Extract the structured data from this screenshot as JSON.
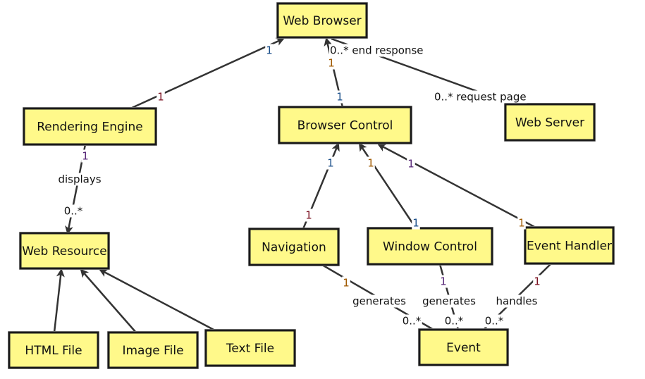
{
  "diagram": {
    "type": "uml-class-diagram",
    "colors": {
      "box_fill": "#fff98a",
      "box_border": "#1a1a1a",
      "edge": "#333333"
    },
    "nodes": [
      {
        "id": "web-browser",
        "label": "Web Browser"
      },
      {
        "id": "rendering-engine",
        "label": "Rendering Engine"
      },
      {
        "id": "browser-control",
        "label": "Browser Control"
      },
      {
        "id": "web-server",
        "label": "Web Server"
      },
      {
        "id": "web-resource",
        "label": "Web Resource"
      },
      {
        "id": "navigation",
        "label": "Navigation"
      },
      {
        "id": "window-control",
        "label": "Window Control"
      },
      {
        "id": "event-handler",
        "label": "Event Handler"
      },
      {
        "id": "html-file",
        "label": "HTML File"
      },
      {
        "id": "image-file",
        "label": "Image File"
      },
      {
        "id": "text-file",
        "label": "Text File"
      },
      {
        "id": "event",
        "label": "Event"
      }
    ],
    "edges": [
      {
        "id": "re-wb",
        "from": "rendering-engine",
        "to": "web-browser",
        "arrow": true,
        "labels": [
          "1",
          "1"
        ]
      },
      {
        "id": "bc-wb",
        "from": "browser-control",
        "to": "web-browser",
        "arrow": true,
        "labels": [
          "1",
          "1"
        ]
      },
      {
        "id": "ws-wb",
        "from": "web-server",
        "to": "web-browser",
        "arrow": false,
        "labels": [
          "0..* end response",
          "0..* request page"
        ]
      },
      {
        "id": "re-wr",
        "from": "rendering-engine",
        "to": "web-resource",
        "arrow": true,
        "labels": [
          "1",
          "displays",
          "0..*"
        ]
      },
      {
        "id": "nav-bc",
        "from": "navigation",
        "to": "browser-control",
        "arrow": true,
        "labels": [
          "1",
          "1"
        ]
      },
      {
        "id": "wc-bc",
        "from": "window-control",
        "to": "browser-control",
        "arrow": true,
        "labels": [
          "1",
          "1"
        ]
      },
      {
        "id": "eh-bc",
        "from": "event-handler",
        "to": "browser-control",
        "arrow": true,
        "labels": [
          "1",
          "1"
        ]
      },
      {
        "id": "html-wr",
        "from": "html-file",
        "to": "web-resource",
        "arrow": true,
        "labels": []
      },
      {
        "id": "img-wr",
        "from": "image-file",
        "to": "web-resource",
        "arrow": true,
        "labels": []
      },
      {
        "id": "txt-wr",
        "from": "text-file",
        "to": "web-resource",
        "arrow": true,
        "labels": []
      },
      {
        "id": "nav-ev",
        "from": "navigation",
        "to": "event",
        "arrow": false,
        "labels": [
          "1",
          "generates",
          "0..*"
        ]
      },
      {
        "id": "wc-ev",
        "from": "window-control",
        "to": "event",
        "arrow": false,
        "labels": [
          "1",
          "generates",
          "0..*"
        ]
      },
      {
        "id": "eh-ev",
        "from": "event-handler",
        "to": "event",
        "arrow": false,
        "labels": [
          "1",
          "handles",
          "0..*"
        ]
      }
    ]
  }
}
